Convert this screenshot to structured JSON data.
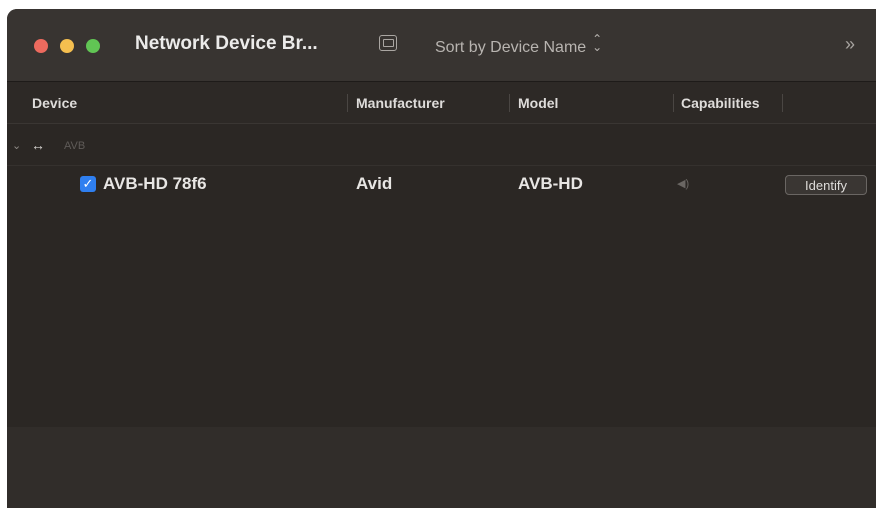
{
  "window": {
    "title": "Network Device Br...",
    "sort_label": "Sort by Device Name",
    "sort_chevron": "⌃⌄",
    "overflow_label": "»"
  },
  "columns": [
    {
      "label": "Device"
    },
    {
      "label": "Manufacturer"
    },
    {
      "label": "Model"
    },
    {
      "label": "Capabilities"
    }
  ],
  "group": {
    "disclosure": "⌄",
    "icon": "↔",
    "label": "AVB"
  },
  "devices": [
    {
      "checked": true,
      "name": "AVB-HD 78f6",
      "manufacturer": "Avid",
      "model": "AVB-HD",
      "capability_icon": "speaker-icon",
      "action_label": "Identify"
    }
  ],
  "colors": {
    "window_bg": "#2b2724",
    "titlebar_bg": "#383431",
    "accent": "#2f7ff0",
    "close": "#ed6a5e",
    "minimize": "#f5bf4f",
    "zoom": "#61c554"
  }
}
